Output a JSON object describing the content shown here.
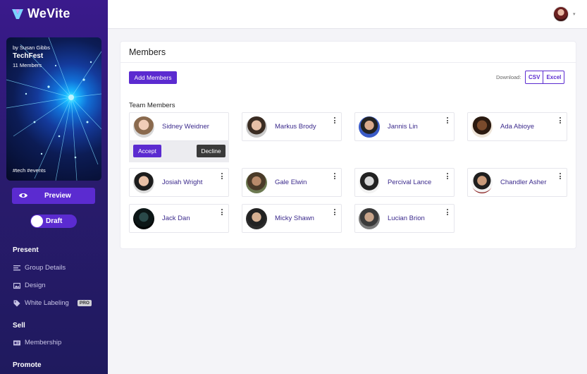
{
  "app": {
    "name": "WeVite"
  },
  "event": {
    "by": "by Susan Gibbs",
    "title": "TechFest",
    "members": "11 Members",
    "tags": "#tech #events"
  },
  "sidebar": {
    "preview_label": "Preview",
    "draft_label": "Draft",
    "sections": [
      {
        "title": "Present",
        "items": [
          {
            "label": "Group Details",
            "icon": "list-icon"
          },
          {
            "label": "Design",
            "icon": "image-icon"
          },
          {
            "label": "White Labeling",
            "icon": "tag-icon",
            "badge": "PRO"
          }
        ]
      },
      {
        "title": "Sell",
        "items": [
          {
            "label": "Membership",
            "icon": "card-icon"
          }
        ]
      },
      {
        "title": "Promote",
        "items": []
      }
    ]
  },
  "main": {
    "title": "Members",
    "add_button": "Add Members",
    "download_label": "Download:",
    "download_options": [
      "CSV",
      "Excel"
    ],
    "team_heading": "Team Members",
    "pending": {
      "name": "Sidney Weidner",
      "accept": "Accept",
      "decline": "Decline"
    },
    "members": [
      "Markus Brody",
      "Jannis Lin",
      "Ada Abioye",
      "Josiah Wright",
      "Gale Elwin",
      "Percival Lance",
      "Chandler Asher",
      "Jack Dan",
      "Micky Shawn",
      "Lucian Brion"
    ]
  },
  "colors": {
    "accent": "#5b2bd0",
    "sidebar": "#2a1b6e",
    "name_text": "#3b2a8c"
  }
}
